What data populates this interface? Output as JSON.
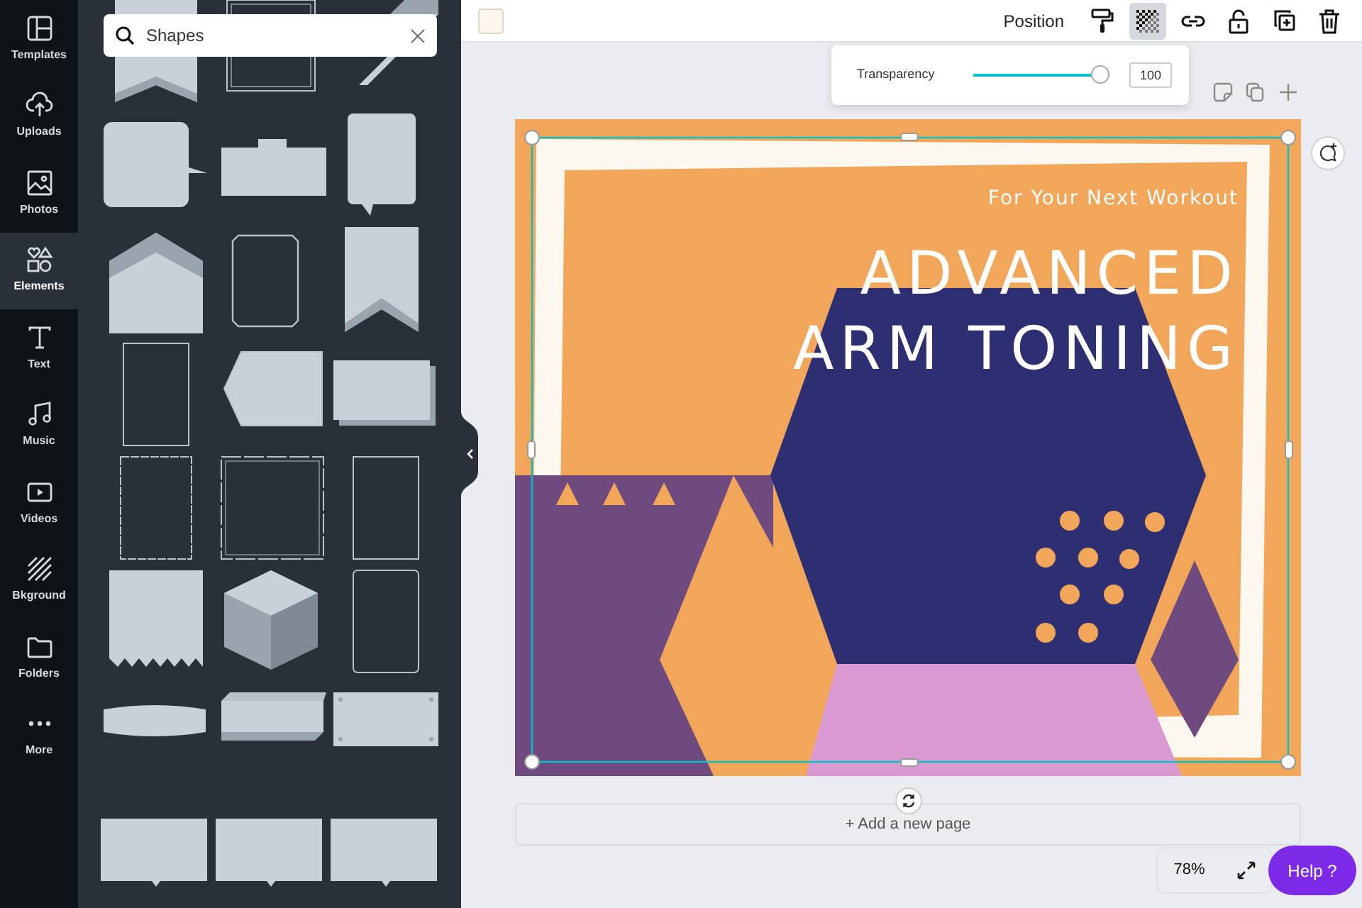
{
  "sidebar": {
    "items": [
      {
        "label": "Templates",
        "selected": false
      },
      {
        "label": "Uploads",
        "selected": false
      },
      {
        "label": "Photos",
        "selected": false
      },
      {
        "label": "Elements",
        "selected": true
      },
      {
        "label": "Text",
        "selected": false
      },
      {
        "label": "Music",
        "selected": false
      },
      {
        "label": "Videos",
        "selected": false
      },
      {
        "label": "Bkground",
        "selected": false
      },
      {
        "label": "Folders",
        "selected": false
      },
      {
        "label": "More",
        "selected": false
      }
    ]
  },
  "search": {
    "value": "Shapes"
  },
  "toolbar": {
    "position": "Position",
    "transparency_selected": true
  },
  "transparency_popup": {
    "label": "Transparency",
    "level": 1,
    "value": "100"
  },
  "poster": {
    "subtitle": "For Your Next Workout",
    "title_lines": [
      "ADVANCED",
      "ARM TONING"
    ]
  },
  "add_page": "+ Add a new page",
  "zoom": "78%",
  "help": "Help ?"
}
